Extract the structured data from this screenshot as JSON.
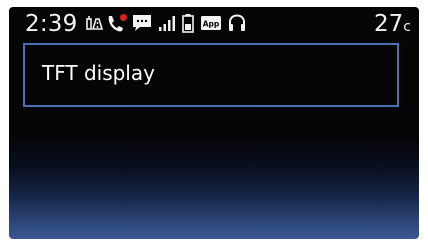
{
  "status_bar": {
    "time": "2:39",
    "temperature_value": "27",
    "temperature_unit": "c",
    "app_badge": "App",
    "icons": [
      "traffic-info-icon",
      "missed-call-icon",
      "message-icon",
      "signal-strength-icon",
      "battery-icon",
      "app-icon",
      "headset-icon"
    ]
  },
  "main": {
    "label": "TFT display"
  },
  "colors": {
    "text": "#f2f2f2",
    "accent_border": "#4a6fb5",
    "missed_call_badge": "#d62020",
    "background": "#050505",
    "bottom_glow": "#3a5a92"
  }
}
